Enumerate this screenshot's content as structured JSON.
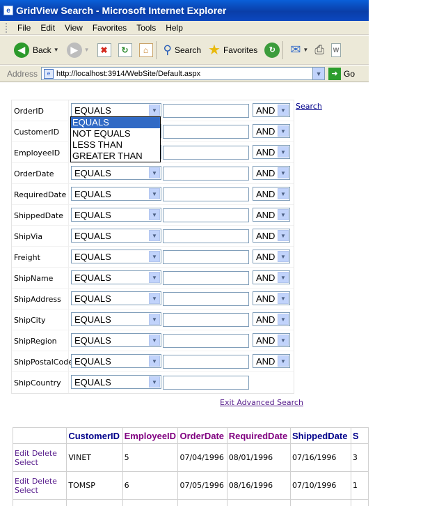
{
  "window": {
    "title": "GridView Search - Microsoft Internet Explorer"
  },
  "menu": [
    "File",
    "Edit",
    "View",
    "Favorites",
    "Tools",
    "Help"
  ],
  "toolbar": {
    "back": "Back",
    "search": "Search",
    "favorites": "Favorites"
  },
  "address": {
    "label": "Address",
    "url": "http://localhost:3914/WebSite/Default.aspx",
    "go": "Go"
  },
  "filter": {
    "rows": [
      {
        "field": "OrderID",
        "operator": "EQUALS",
        "conj": "AND"
      },
      {
        "field": "CustomerID",
        "operator": "EQUALS",
        "conj": "AND"
      },
      {
        "field": "EmployeeID",
        "operator": "EQUALS",
        "conj": "AND"
      },
      {
        "field": "OrderDate",
        "operator": "EQUALS",
        "conj": "AND"
      },
      {
        "field": "RequiredDate",
        "operator": "EQUALS",
        "conj": "AND"
      },
      {
        "field": "ShippedDate",
        "operator": "EQUALS",
        "conj": "AND"
      },
      {
        "field": "ShipVia",
        "operator": "EQUALS",
        "conj": "AND"
      },
      {
        "field": "Freight",
        "operator": "EQUALS",
        "conj": "AND"
      },
      {
        "field": "ShipName",
        "operator": "EQUALS",
        "conj": "AND"
      },
      {
        "field": "ShipAddress",
        "operator": "EQUALS",
        "conj": "AND"
      },
      {
        "field": "ShipCity",
        "operator": "EQUALS",
        "conj": "AND"
      },
      {
        "field": "ShipRegion",
        "operator": "EQUALS",
        "conj": "AND"
      },
      {
        "field": "ShipPostalCode",
        "operator": "EQUALS",
        "conj": "AND"
      },
      {
        "field": "ShipCountry",
        "operator": "EQUALS",
        "conj": ""
      }
    ],
    "dropdown_options": [
      "EQUALS",
      "NOT EQUALS",
      "LESS THAN",
      "GREATER THAN"
    ],
    "search_link": "Search",
    "exit_link": "Exit Advanced Search"
  },
  "grid": {
    "headers": [
      "CustomerID",
      "EmployeeID",
      "OrderDate",
      "RequiredDate",
      "ShippedDate",
      "S"
    ],
    "rows": [
      {
        "edit": "Edit",
        "delete": "Delete",
        "select": "Select",
        "CustomerID": "VINET",
        "EmployeeID": "5",
        "OrderDate": "07/04/1996",
        "RequiredDate": "08/01/1996",
        "ShippedDate": "07/16/1996",
        "S": "3"
      },
      {
        "edit": "Edit",
        "delete": "Delete",
        "select": "Select",
        "CustomerID": "TOMSP",
        "EmployeeID": "6",
        "OrderDate": "07/05/1996",
        "RequiredDate": "08/16/1996",
        "ShippedDate": "07/10/1996",
        "S": "1"
      }
    ]
  }
}
